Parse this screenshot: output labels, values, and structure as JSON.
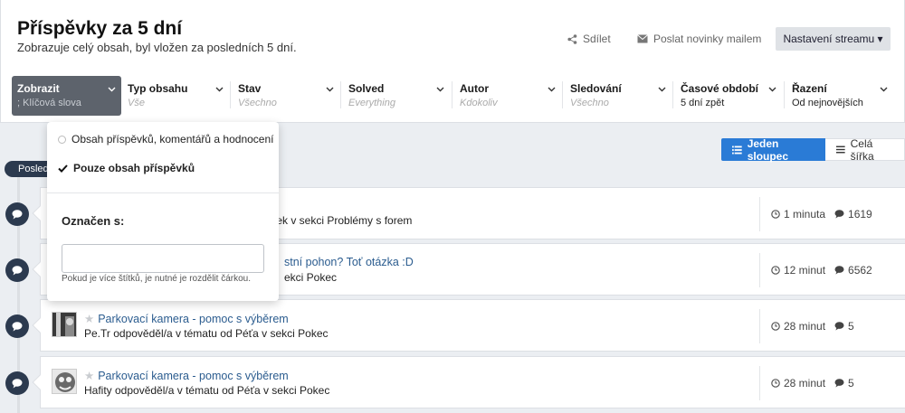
{
  "page": {
    "title": "Příspěvky za 5 dní",
    "subtitle": "Zobrazuje celý obsah, byl vložen za posledních 5 dní."
  },
  "header_buttons": {
    "share": "Sdílet",
    "mail": "Poslat novinky mailem",
    "stream_settings": "Nastavení streamu ▾"
  },
  "filters": [
    {
      "label": "Zobrazit",
      "value": "; Klíčová slova",
      "active": true
    },
    {
      "label": "Typ obsahu",
      "value": "Vše"
    },
    {
      "label": "Stav",
      "value": "Všechno"
    },
    {
      "label": "Solved",
      "value": "Everything"
    },
    {
      "label": "Autor",
      "value": "Kdokoliv"
    },
    {
      "label": "Sledování",
      "value": "Všechno"
    },
    {
      "label": "Časové období",
      "value": "5 dní zpět",
      "set": true
    },
    {
      "label": "Řazení",
      "value": "Od nejnovějších",
      "set": true
    }
  ],
  "dropdown": {
    "option_all": "Obsah příspěvků, komentářů a hodnocení",
    "option_posts": "Pouze obsah příspěvků",
    "tag_label": "Označen s:",
    "tag_input_value": "",
    "tag_hint": "Pokud je více štítků, je nutné je rozdělit čárkou."
  },
  "timeline": {
    "pill": "Posled"
  },
  "view_toggle": {
    "single": "Jeden sloupec",
    "full": "Celá šířka"
  },
  "stream": [
    {
      "title": "",
      "subtitle": "hreek v sekci Problémy s forem",
      "time": "1 minuta",
      "comments": "1619"
    },
    {
      "title": "stní pohon? Toť otázka :D",
      "subtitle": "ekci Pokec",
      "time": "12 minut",
      "comments": "6562"
    },
    {
      "title": "Parkovací kamera - pomoc s výběrem",
      "subtitle": "Pe.Tr odpověděl/a v tématu od Péťa v sekci Pokec",
      "time": "28 minut",
      "comments": "5"
    },
    {
      "title": "Parkovací kamera - pomoc s výběrem",
      "subtitle": "Hafity odpověděl/a v tématu od Péťa v sekci Pokec",
      "time": "28 minut",
      "comments": "5"
    }
  ],
  "colors": {
    "accent": "#2a7bd6",
    "active_filter": "#5d636c",
    "timeline_bubble": "#2c3a4f",
    "link": "#2b5c8f"
  }
}
